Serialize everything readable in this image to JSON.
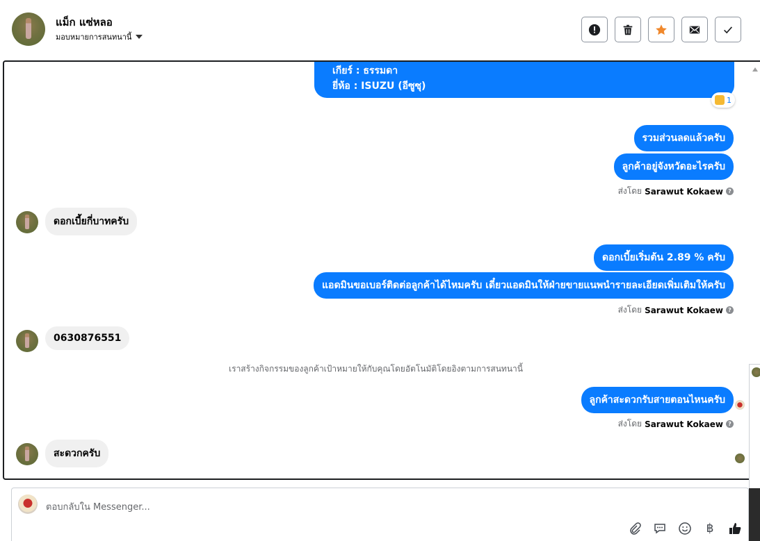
{
  "header": {
    "name": "แม็ก แซ่หลอ",
    "assign_label": "มอบหมายการสนทนานี้",
    "actions": [
      "spam-icon",
      "trash-icon",
      "star-icon",
      "mail-icon",
      "check-icon"
    ],
    "star_color": "#f0882c"
  },
  "chat": {
    "top_bubble": {
      "line1": "เกียร์ : ธรรมดา",
      "line2": "ยี่ห้อ : ISUZU (อีซูซุ)",
      "reaction_count": "1"
    },
    "messages": [
      {
        "dir": "out",
        "text": "รวมส่วนลดแล้วครับ"
      },
      {
        "dir": "out",
        "text": "ลูกค้าอยู่จังหวัดอะไรครับ"
      },
      {
        "dir": "sent_by",
        "prefix": "ส่งโดย",
        "name": "Sarawut Kokaew"
      },
      {
        "dir": "in",
        "text": "ดอกเบี้ยกี่บาทครับ"
      },
      {
        "dir": "out",
        "text": "ดอกเบี้ยเริ่มต้น 2.89 % ครับ"
      },
      {
        "dir": "out",
        "text": "แอดมินขอเบอร์ติดต่อลูกค้าได้ไหมครับ เดี๋ยวแอดมินให้ฝ่ายขายแนพนำรายละเอียดเพิ่มเติมให้ครับ"
      },
      {
        "dir": "sent_by",
        "prefix": "ส่งโดย",
        "name": "Sarawut Kokaew"
      },
      {
        "dir": "in",
        "text": "0630876551"
      },
      {
        "dir": "system",
        "text": "เราสร้างกิจกรรมของลูกค้าเป้าหมายให้กับคุณโดยอัตโนมัติโดยอิงตามการสนทนานี้"
      },
      {
        "dir": "out",
        "text": "ลูกค้าสะดวกรับสายตอนไหนครับ"
      },
      {
        "dir": "sent_by",
        "prefix": "ส่งโดย",
        "name": "Sarawut Kokaew"
      },
      {
        "dir": "in",
        "text": "สะดวกครับ"
      }
    ],
    "bubble_out_color": "#0a7cff",
    "bubble_in_color": "#f0f0f0"
  },
  "composer": {
    "placeholder": "ตอบกลับใน Messenger...",
    "tools": [
      "attachment-icon",
      "saved-replies-icon",
      "emoji-icon",
      "baht-icon",
      "like-icon"
    ],
    "baht_symbol": "฿"
  }
}
